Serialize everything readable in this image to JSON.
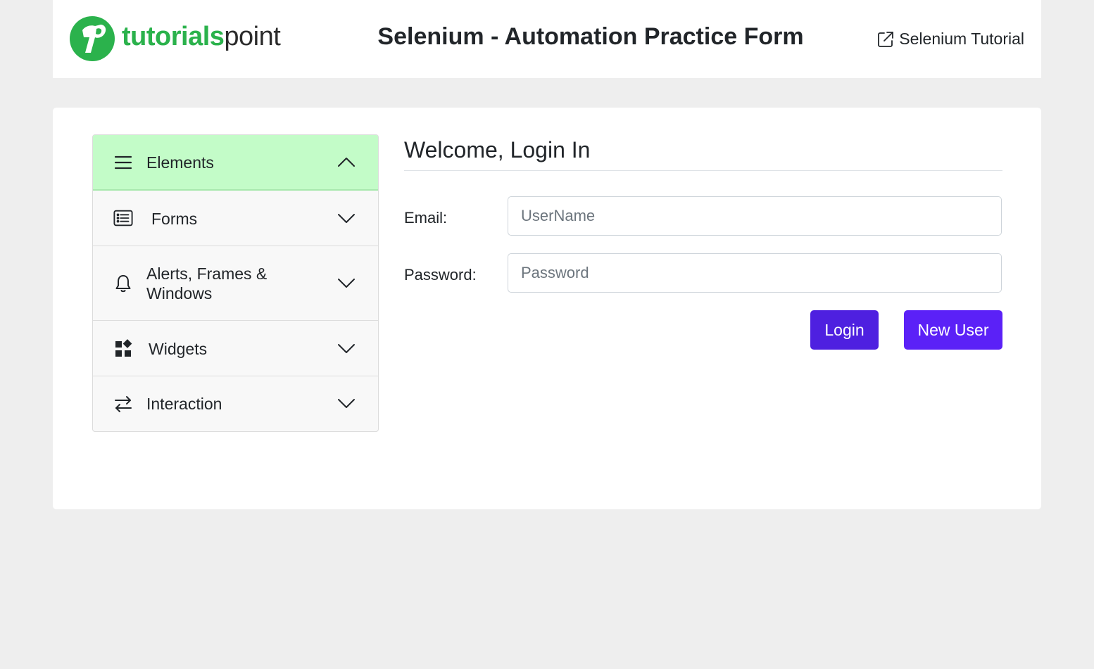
{
  "header": {
    "logo_bold": "tutorials",
    "logo_light": "point",
    "title": "Selenium - Automation Practice Form",
    "tutorial_link": "Selenium Tutorial"
  },
  "sidebar": {
    "items": [
      {
        "label": "Elements",
        "icon": "menu-icon",
        "expanded": true
      },
      {
        "label": "Forms",
        "icon": "list-icon",
        "expanded": false
      },
      {
        "label": "Alerts, Frames &",
        "label2": "Windows",
        "icon": "bell-icon",
        "expanded": false
      },
      {
        "label": "Widgets",
        "icon": "widgets-icon",
        "expanded": false
      },
      {
        "label": "Interaction",
        "icon": "arrows-exchange-icon",
        "expanded": false
      }
    ]
  },
  "form": {
    "title": "Welcome, Login In",
    "email_label": "Email:",
    "email_placeholder": "UserName",
    "email_value": "",
    "password_label": "Password:",
    "password_placeholder": "Password",
    "password_value": "",
    "login_button": "Login",
    "new_user_button": "New User"
  },
  "colors": {
    "brand_green": "#2bb24c",
    "active_item_bg": "#c3fcc8",
    "login_button": "#4e20e0",
    "new_user_button": "#5b21f7",
    "page_bg": "#eeeeee"
  }
}
